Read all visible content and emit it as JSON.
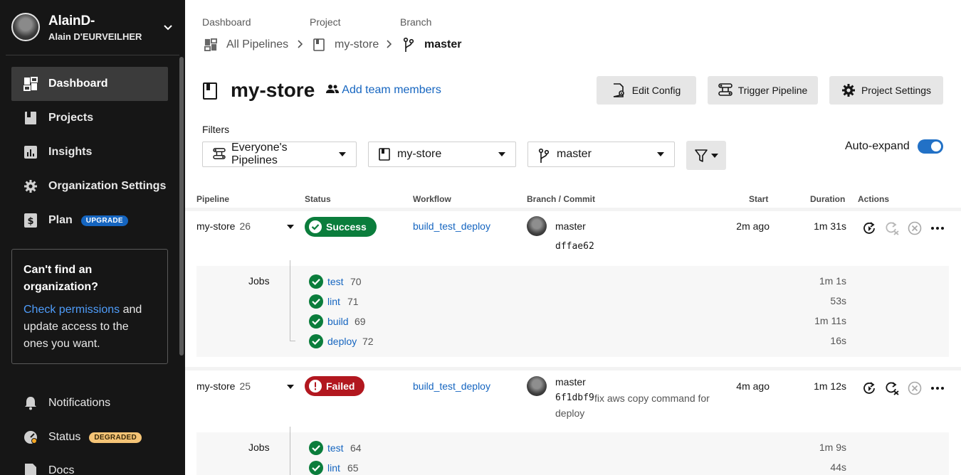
{
  "user": {
    "handle": "AlainD-",
    "full_name": "Alain D'EURVEILHER"
  },
  "sidebar": {
    "items": [
      {
        "label": "Dashboard",
        "icon": "dashboard-icon"
      },
      {
        "label": "Projects",
        "icon": "project-icon"
      },
      {
        "label": "Insights",
        "icon": "insights-icon"
      },
      {
        "label": "Organization Settings",
        "icon": "gear-icon"
      },
      {
        "label": "Plan",
        "icon": "plan-icon",
        "badge": "UPGRADE"
      }
    ],
    "org_card": {
      "title": "Can't find an organization?",
      "link": "Check permissions",
      "text": " and update access to the ones you want."
    },
    "bottom_items": [
      {
        "label": "Notifications",
        "icon": "bell-icon"
      },
      {
        "label": "Status",
        "icon": "status-icon",
        "badge": "DEGRADED"
      },
      {
        "label": "Docs",
        "icon": "docs-icon"
      }
    ]
  },
  "breadcrumb": {
    "labels": [
      "Dashboard",
      "Project",
      "Branch"
    ],
    "items": [
      "All Pipelines",
      "my-store",
      "master"
    ]
  },
  "header": {
    "title": "my-store",
    "add_team": "Add team members",
    "buttons": {
      "edit_config": "Edit Config",
      "trigger": "Trigger Pipeline",
      "settings": "Project Settings"
    }
  },
  "filters": {
    "label": "Filters",
    "pipelines": "Everyone's Pipelines",
    "project": "my-store",
    "branch": "master",
    "auto_expand": "Auto-expand",
    "auto_expand_on": true
  },
  "table": {
    "headers": [
      "Pipeline",
      "Status",
      "Workflow",
      "Branch / Commit",
      "Start",
      "Duration",
      "Actions"
    ],
    "jobs_label": "Jobs",
    "pipelines": [
      {
        "name": "my-store",
        "number": "26",
        "status": "Success",
        "workflow": "build_test_deploy",
        "branch": "master",
        "commit": "dffae62",
        "message": "",
        "start": "2m ago",
        "duration": "1m 31s",
        "jobs": [
          {
            "name": "test",
            "number": "70",
            "duration": "1m 1s"
          },
          {
            "name": "lint",
            "number": "71",
            "duration": "53s"
          },
          {
            "name": "build",
            "number": "69",
            "duration": "1m 11s"
          },
          {
            "name": "deploy",
            "number": "72",
            "duration": "16s"
          }
        ]
      },
      {
        "name": "my-store",
        "number": "25",
        "status": "Failed",
        "workflow": "build_test_deploy",
        "branch": "master",
        "commit": "6f1dbf9",
        "message": "fix aws copy command for deploy",
        "start": "4m ago",
        "duration": "1m 12s",
        "jobs": [
          {
            "name": "test",
            "number": "64",
            "duration": "1m 9s"
          },
          {
            "name": "lint",
            "number": "65",
            "duration": "44s"
          }
        ]
      }
    ]
  },
  "colors": {
    "accent": "#1565c0",
    "success": "#0b7d3c",
    "failed": "#b2171f",
    "sidebar": "#161616"
  }
}
